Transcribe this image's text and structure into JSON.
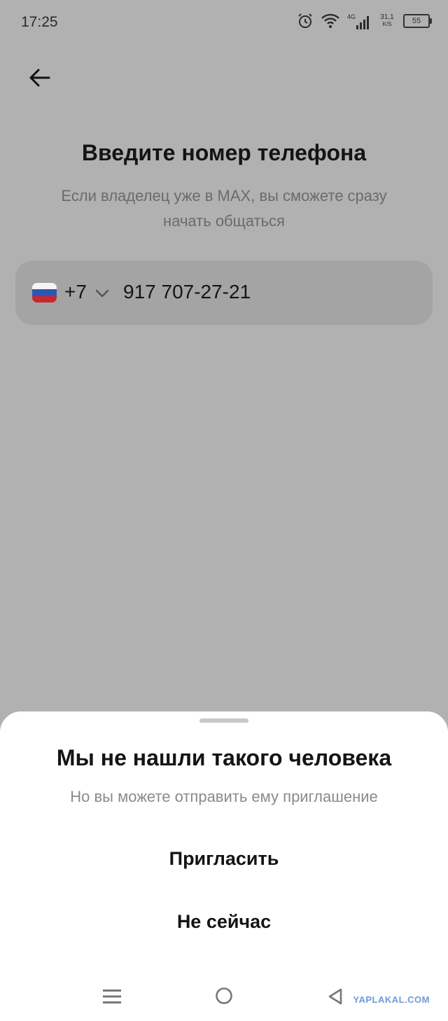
{
  "status_bar": {
    "time": "17:25",
    "network": "4G",
    "speed_value": "31,1",
    "speed_unit": "K/S",
    "battery": "55",
    "icons": [
      "alarm-icon",
      "wifi-icon",
      "signal-icon",
      "battery-icon"
    ]
  },
  "header": {
    "back_icon": "arrow-left-icon"
  },
  "main": {
    "title": "Введите номер телефона",
    "subtitle": "Если владелец уже в MAX, вы сможете сразу начать общаться",
    "phone": {
      "country_flag": "russia-flag-icon",
      "country_code": "+7",
      "number": "917 707-27-21"
    }
  },
  "sheet": {
    "title": "Мы не нашли такого человека",
    "subtitle": "Но вы можете отправить ему приглашение",
    "invite_label": "Пригласить",
    "not_now_label": "Не сейчас"
  },
  "nav": {
    "icons": [
      "menu-icon",
      "home-icon",
      "back-triangle-icon"
    ],
    "watermark": "YAPLAKAL.COM"
  },
  "colors": {
    "overlay_bg": "#b1b1b1",
    "sheet_bg": "#ffffff",
    "text_primary": "#141414",
    "text_secondary": "#8a8a8a"
  }
}
